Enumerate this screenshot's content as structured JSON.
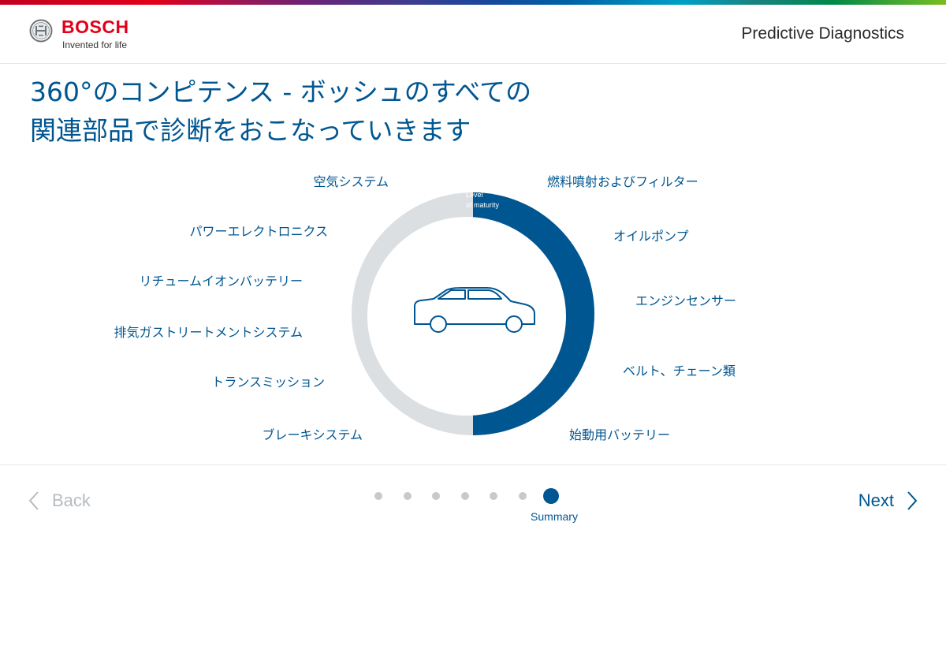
{
  "brand": {
    "name": "BOSCH",
    "tagline": "Invented for life"
  },
  "header": {
    "app_title": "Predictive Diagnostics"
  },
  "headline": {
    "line1": "360°のコンピテンス - ボッシュのすべての",
    "line2": "関連部品で診断をおこなっていきます"
  },
  "diagram": {
    "maturity_label_line1": "Level",
    "maturity_label_line2": "of maturity",
    "maturity_fraction": 0.5,
    "left_labels": [
      "空気システム",
      "パワーエレクトロニクス",
      "リチュームイオンバッテリー",
      "排気ガストリートメントシステム",
      "トランスミッション",
      "ブレーキシステム"
    ],
    "right_labels": [
      "燃料噴射およびフィルター",
      "オイルポンプ",
      "エンジンセンサー",
      "ベルト、チェーン類",
      "始動用バッテリー"
    ],
    "center_icon": "car-icon",
    "colors": {
      "accent": "#005691",
      "track": "#dcdfe1"
    }
  },
  "nav": {
    "back_label": "Back",
    "next_label": "Next",
    "total_steps": 7,
    "current_step": 7,
    "current_step_label": "Summary"
  }
}
